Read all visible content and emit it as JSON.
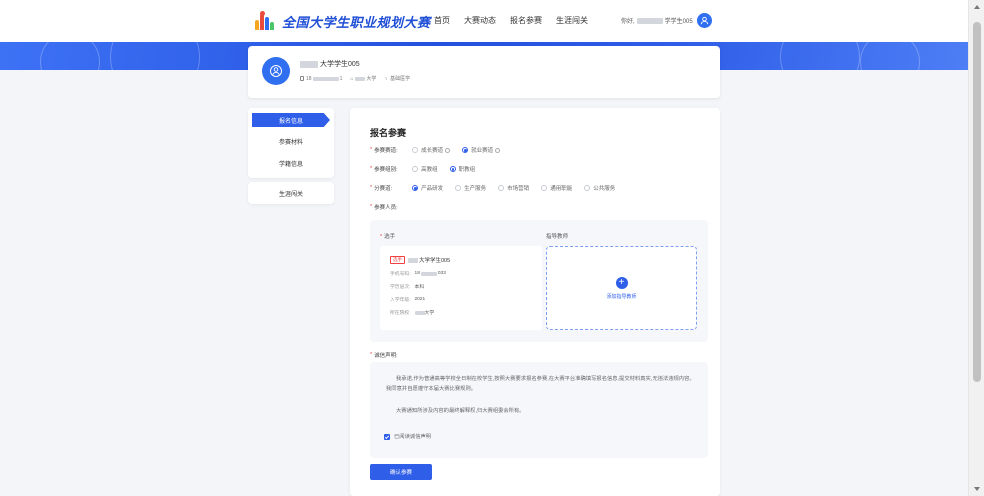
{
  "header": {
    "logo_text": "全国大学生职业规划大赛",
    "nav": [
      "首页",
      "大赛动态",
      "报名参赛",
      "生涯闯关"
    ],
    "greeting": "你好,",
    "user_suffix": "学学生005"
  },
  "profile": {
    "name_suffix": "大学学生005",
    "phone_prefix": "18",
    "phone_suffix": "1",
    "school_suffix": "大学",
    "major": "基础医学"
  },
  "sidebar": {
    "items": [
      "报名信息",
      "参赛材料",
      "学籍信息"
    ],
    "extra": "生涯闯关"
  },
  "form": {
    "title": "报名参赛",
    "track": {
      "label": "参赛赛道:",
      "options": [
        "成长赛道",
        "就业赛道"
      ],
      "selected": 1
    },
    "group": {
      "label": "参赛组别:",
      "options": [
        "高教组",
        "职教组"
      ],
      "selected": 1
    },
    "sub_track": {
      "label": "分赛道:",
      "options": [
        "产品研发",
        "生产服务",
        "市场营销",
        "通用职能",
        "公共服务"
      ],
      "selected": 0
    },
    "members_label": "参赛人员:",
    "player_label": "选手",
    "teacher_label": "指导教师",
    "student": {
      "tag": "选手",
      "name_suffix": "大学学生005",
      "phone_label": "手机号码:",
      "phone_prefix": "18",
      "phone_suffix": "033",
      "edu_label": "学历层次:",
      "edu": "本科",
      "year_label": "入学年级:",
      "year": "2021",
      "school_label": "所在院校:",
      "school_suffix": "大学"
    },
    "add_teacher": "添加指导教师",
    "decl_label": "诚信声明:",
    "decl_p1": "我承诺,作为普通高等学校全日制在校学生,按照大赛要求报名参赛,在大赛平台准确填写报名信息,提交材料真实,无违法违规内容。我同意并自愿遵守本届大赛比赛规则。",
    "decl_p2": "大赛通知所涉及内容的最终解释权,归大赛组委会所有。",
    "checkbox_label": "已阅读诚信声明",
    "submit": "确认参赛"
  },
  "colors": {
    "primary": "#2f5ee8",
    "required": "#f04040"
  }
}
